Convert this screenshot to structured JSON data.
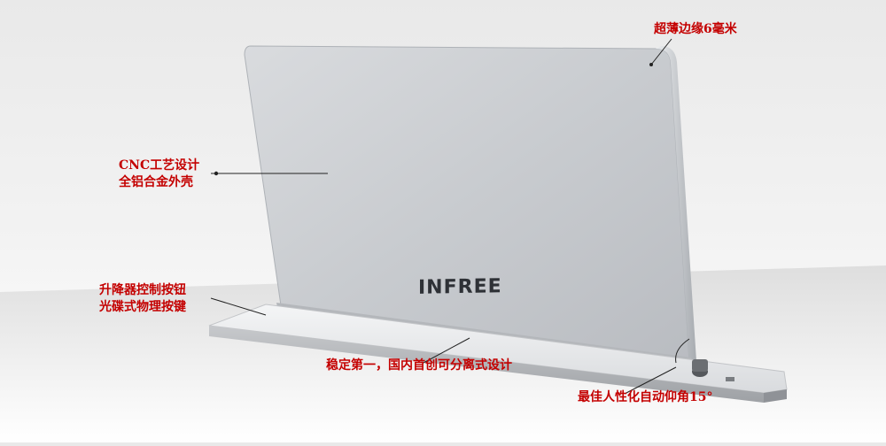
{
  "product": {
    "brand": "INFREE"
  },
  "annotations": {
    "bezel": "超薄边缘6毫米",
    "shell_line1": "CNC工艺设计",
    "shell_line2": "全铝合金外壳",
    "button_line1": "升降器控制按钮",
    "button_line2": "光碟式物理按键",
    "stability": "稳定第一，国内首创可分离式设计",
    "tilt": "最佳人性化自动仰角15°"
  },
  "colors": {
    "annotation_text": "#c40000",
    "screen_back": "#c9ccd0",
    "base": "#e2e3e5"
  }
}
